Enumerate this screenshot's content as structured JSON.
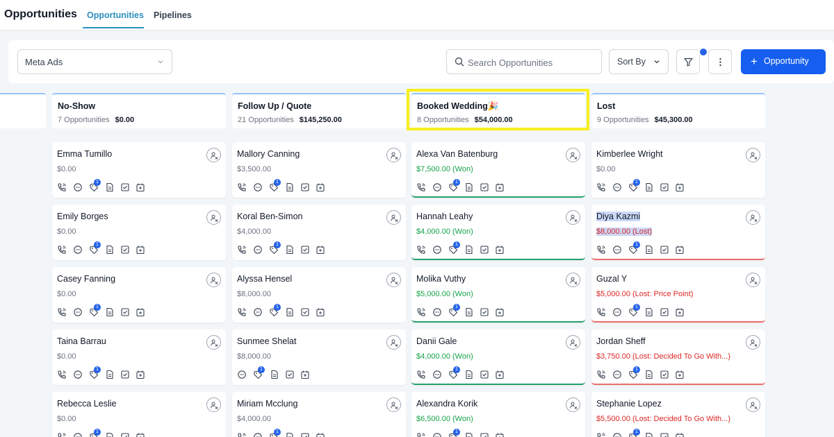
{
  "header": {
    "title": "Opportunities",
    "tabs": [
      {
        "label": "Opportunities",
        "active": true
      },
      {
        "label": "Pipelines",
        "active": false
      }
    ]
  },
  "toolbar": {
    "pipeline_value": "Meta Ads",
    "search_placeholder": "Search Opportunities",
    "sort_label": "Sort By",
    "add_label": "Opportunity"
  },
  "colors": {
    "accent": "#155eef",
    "won": "#16a34a",
    "lost": "#dc2626",
    "highlight": "#f7ef1e"
  },
  "columns": [
    {
      "name": "No-Show",
      "count": "7 Opportunities",
      "amount": "$0.00",
      "cards": [
        {
          "name": "Emma Tumillo",
          "value": "$0.00",
          "status": "",
          "badge": "1",
          "icons": "full"
        },
        {
          "name": "Emily Borges",
          "value": "$0.00",
          "status": "",
          "badge": "1",
          "icons": "full"
        },
        {
          "name": "Casey Fanning",
          "value": "$0.00",
          "status": "",
          "badge": "1",
          "icons": "full"
        },
        {
          "name": "Taina Barrau",
          "value": "$0.00",
          "status": "",
          "badge": "1",
          "icons": "full"
        },
        {
          "name": "Rebecca Leslie",
          "value": "$0.00",
          "status": "",
          "badge": "1",
          "icons": "full"
        }
      ]
    },
    {
      "name": "Follow Up / Quote",
      "count": "21 Opportunities",
      "amount": "$145,250.00",
      "cards": [
        {
          "name": "Mallory Canning",
          "value": "$3,500.00",
          "status": "",
          "badge": "1",
          "icons": "full"
        },
        {
          "name": "Koral Ben-Simon",
          "value": "$4,000.00",
          "status": "",
          "badge": "1",
          "icons": "full"
        },
        {
          "name": "Alyssa Hensel",
          "value": "$8,000.00",
          "status": "",
          "badge": "1",
          "icons": "full"
        },
        {
          "name": "Sunmee Shelat",
          "value": "$8,000.00",
          "status": "",
          "badge": "1",
          "icons": "nophone"
        },
        {
          "name": "Miriam Mcclung",
          "value": "$4,000.00",
          "status": "",
          "badge": "1",
          "icons": "full"
        }
      ]
    },
    {
      "name": "Booked Wedding🎉",
      "count": "8 Opportunities",
      "amount": "$54,000.00",
      "cards": [
        {
          "name": "Alexa Van Batenburg",
          "value": "$7,500.00 (Won)",
          "status": "won",
          "badge": "1",
          "icons": "full"
        },
        {
          "name": "Hannah Leahy",
          "value": "$4,000.00 (Won)",
          "status": "won",
          "badge": "1",
          "icons": "full"
        },
        {
          "name": "Molika Vuthy",
          "value": "$5,000.00 (Won)",
          "status": "won",
          "badge": "1",
          "icons": "full"
        },
        {
          "name": "Danii Gale",
          "value": "$4,000.00 (Won)",
          "status": "won",
          "badge": "1",
          "icons": "full"
        },
        {
          "name": "Alexandra Korik",
          "value": "$6,500.00 (Won)",
          "status": "won",
          "badge": "1",
          "icons": "full"
        }
      ]
    },
    {
      "name": "Lost",
      "count": "9 Opportunities",
      "amount": "$45,300.00",
      "cards": [
        {
          "name": "Kimberlee Wright",
          "value": "$0.00",
          "status": "",
          "badge": "1",
          "icons": "full"
        },
        {
          "name": "Diya Kazmi",
          "value": "$8,000.00 (Lost)",
          "status": "lost",
          "badge": "1",
          "icons": "full"
        },
        {
          "name": "Guzal Y",
          "value": "$5,000.00 (Lost: Price Point)",
          "status": "lost",
          "badge": "1",
          "icons": "full"
        },
        {
          "name": "Jordan Sheff",
          "value": "$3,750.00 (Lost: Decided To Go With...)",
          "status": "lost",
          "badge": "1",
          "icons": "full"
        },
        {
          "name": "Stephanie Lopez",
          "value": "$5,500.00 (Lost: Decided To Go With...)",
          "status": "lost",
          "badge": "1",
          "icons": "full"
        }
      ]
    }
  ]
}
